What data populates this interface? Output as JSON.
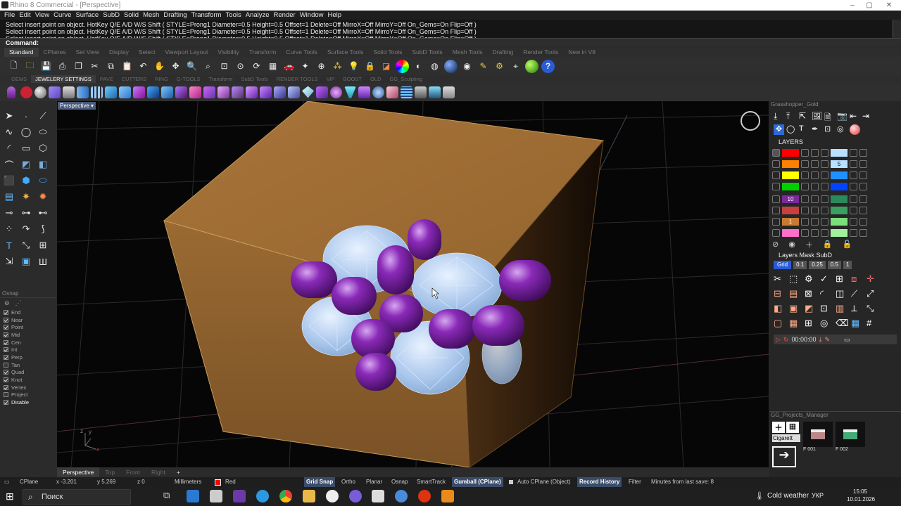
{
  "window": {
    "title": "Rhino 8 Commercial - [Perspective]",
    "controls": [
      "–",
      "▢",
      "✕"
    ]
  },
  "menu": [
    "File",
    "Edit",
    "View",
    "Curve",
    "Surface",
    "SubD",
    "Solid",
    "Mesh",
    "Drafting",
    "Transform",
    "Tools",
    "Analyze",
    "Render",
    "Window",
    "Help"
  ],
  "command_history": [
    "Select insert point on object. HotKey Q/E A/D W/S Shift ( STYLE=Prong1  Diameter=0.5  Height=0.5  Offset=1  Delete=Off  MirroX=Off  MirroY=Off  On_Gems=On  Flip=Off )",
    "Select insert point on object. HotKey Q/E A/D W/S Shift ( STYLE=Prong1  Diameter=0.5  Height=0.5  Offset=1  Delete=Off  MirroX=Off  MirroY=Off  On_Gems=On  Flip=Off )",
    "Select insert point on object. HotKey Q/E A/D W/S Shift ( STYLE=Prong1  Diameter=0.5  Height=0.5  Offset=1  Delete=Off  MirroX=Off  MirroY=Off  On_Gems=On  Flip=Off )"
  ],
  "command_prompt": "Command:",
  "toolbar_tabs": [
    "Standard",
    "CPlanes",
    "Set View",
    "Display",
    "Select",
    "Viewport Layout",
    "Visibility",
    "Transform",
    "Curve Tools",
    "Surface Tools",
    "Solid Tools",
    "SubD Tools",
    "Mesh Tools",
    "Drafting",
    "Render Tools",
    "New in V8"
  ],
  "active_toolbar_tab": "Standard",
  "plugin_tabs": [
    "GEMS",
    "JEWELERY SETTINGS",
    "PAVE",
    "CUTTERS",
    "RING",
    "G-TOOLS",
    "Transform",
    "SubD Tools",
    "RENDER TOOLS",
    "VIP",
    "BOOST",
    "OLD",
    "GG_Sculpting"
  ],
  "active_plugin_tab": "JEWELERY SETTINGS",
  "osnap": {
    "title": "Osnap",
    "items": [
      {
        "label": "End",
        "checked": true
      },
      {
        "label": "Near",
        "checked": true
      },
      {
        "label": "Point",
        "checked": true
      },
      {
        "label": "Mid",
        "checked": true
      },
      {
        "label": "Cen",
        "checked": true
      },
      {
        "label": "Int",
        "checked": true
      },
      {
        "label": "Perp",
        "checked": true
      },
      {
        "label": "Tan",
        "checked": false
      },
      {
        "label": "Quad",
        "checked": true
      },
      {
        "label": "Knot",
        "checked": true
      },
      {
        "label": "Vertex",
        "checked": true
      },
      {
        "label": "Project",
        "checked": false
      },
      {
        "label": "Disable",
        "checked": true
      }
    ]
  },
  "viewport": {
    "title": "Perspective",
    "axis_labels": {
      "z": "z",
      "y": "y",
      "x": "x"
    },
    "tabs": [
      "Perspective",
      "Top",
      "Front",
      "Right"
    ],
    "add_tab": "+"
  },
  "right_panel": {
    "grasshopper_title": "Grasshopper_Gold",
    "layers_title": "LAYERS",
    "layer_rows": [
      {
        "color": "#ff0000",
        "label": "",
        "right_color": "#b8e0ff",
        "right_label": ""
      },
      {
        "color": "#ff7f00",
        "label": "",
        "right_color": "#b8e0ff",
        "right_label": "5"
      },
      {
        "color": "#ffff00",
        "label": "",
        "right_color": "#1e90ff",
        "right_label": ""
      },
      {
        "color": "#00d000",
        "label": "",
        "right_color": "#0044ff",
        "right_label": ""
      },
      {
        "color": "#7a2a9a",
        "label": "10",
        "right_color": "#2a8a5a",
        "right_label": ""
      },
      {
        "color": "#c84040",
        "label": "",
        "right_color": "#3aa060",
        "right_label": ""
      },
      {
        "color": "#c87a30",
        "label": "1",
        "right_color": "#7adf7a",
        "right_label": ""
      },
      {
        "color": "#ff6ec7",
        "label": "",
        "right_color": "#a0f0a0",
        "right_label": ""
      }
    ],
    "subd_title": "Layers Mask SubD",
    "grid_buttons": [
      "Grid",
      "0.1",
      "0.25",
      "0.5",
      "1"
    ],
    "timer": "00:00:00",
    "projects_title": "GG_Projects_Manager",
    "project_item": "Cigarett",
    "project_ids": [
      "F 001",
      "F 002"
    ]
  },
  "status": {
    "cplane": "CPlane",
    "x": "x -3.201",
    "y": "y 5.269",
    "z": "z 0",
    "units": "Millimeters",
    "layer": "Red",
    "layer_color": "#ff0000",
    "toggles": [
      "Grid Snap",
      "Ortho",
      "Planar",
      "Osnap",
      "SmartTrack",
      "Gumball (CPlane)",
      "Auto CPlane (Object)",
      "Record History",
      "Filter"
    ],
    "active_toggles": [
      "Grid Snap",
      "Gumball (CPlane)",
      "Record History"
    ],
    "save_info": "Minutes from last save: 8"
  },
  "taskbar": {
    "search_placeholder": "Поиск",
    "weather": "Cold weather",
    "language": "УКР",
    "time": "15:05",
    "date": "10.01.2026"
  },
  "colors": {
    "box": "#9a6a2e",
    "gem": "#a9c7ec",
    "prong": "#7a1fa0"
  }
}
